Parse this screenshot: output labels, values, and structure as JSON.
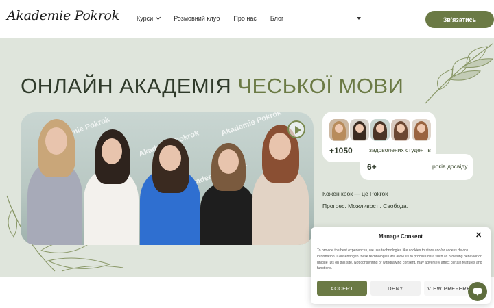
{
  "header": {
    "logo_text": "Akademie Pokrok",
    "nav": [
      {
        "label": "Курси",
        "has_dropdown": true
      },
      {
        "label": "Розмовний клуб"
      },
      {
        "label": "Про нас"
      },
      {
        "label": "Блог"
      }
    ],
    "contact_label": "Зв'язатись"
  },
  "hero": {
    "title_part1": "ОНЛАЙН АКАДЕМІЯ",
    "title_part2": "ЧЕСЬКОЇ МОВИ",
    "photo_watermark": "Akademie Pokrok",
    "stats": [
      {
        "value": "+1050",
        "label": "задоволених студентів"
      },
      {
        "value": "6+",
        "label": "років досвіду"
      }
    ],
    "tagline1": "Кожен крок — це Pokrok",
    "tagline2": "Прогрес. Можливості. Свобода."
  },
  "consent": {
    "title": "Manage Consent",
    "text": "To provide the best experiences, we use technologies like cookies to store and/or access device information. Consenting to these technologies will allow us to process data such as browsing behavior or unique IDs on this site. Not consenting or withdrawing consent, may adversely affect certain features and functions.",
    "accept": "ACCEPT",
    "deny": "DENY",
    "preferences": "VIEW PREFERENCES"
  },
  "colors": {
    "accent": "#6b7a45",
    "hero_bg": "#dfe5dc",
    "title_dark": "#2f3a2a"
  },
  "icons": {
    "play": "play-icon",
    "close": "close-icon",
    "chat": "chat-icon",
    "dropdown": "chevron-down-icon"
  }
}
